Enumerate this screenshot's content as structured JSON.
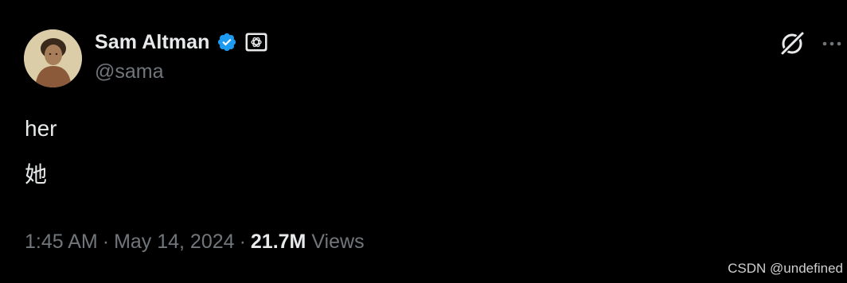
{
  "author": {
    "display_name": "Sam Altman",
    "handle": "@sama",
    "verified_color": "#1d9bf0"
  },
  "tweet": {
    "lines": [
      "her",
      "她"
    ]
  },
  "meta": {
    "time": "1:45 AM",
    "separator": "·",
    "date": "May 14, 2024",
    "views_count": "21.7M",
    "views_label": "Views"
  },
  "icons": {
    "verified": "verified-check-icon",
    "affiliate": "openai-logo-icon",
    "grok": "grok-icon",
    "more": "more-horizontal-icon"
  },
  "watermark": "CSDN @undefined"
}
